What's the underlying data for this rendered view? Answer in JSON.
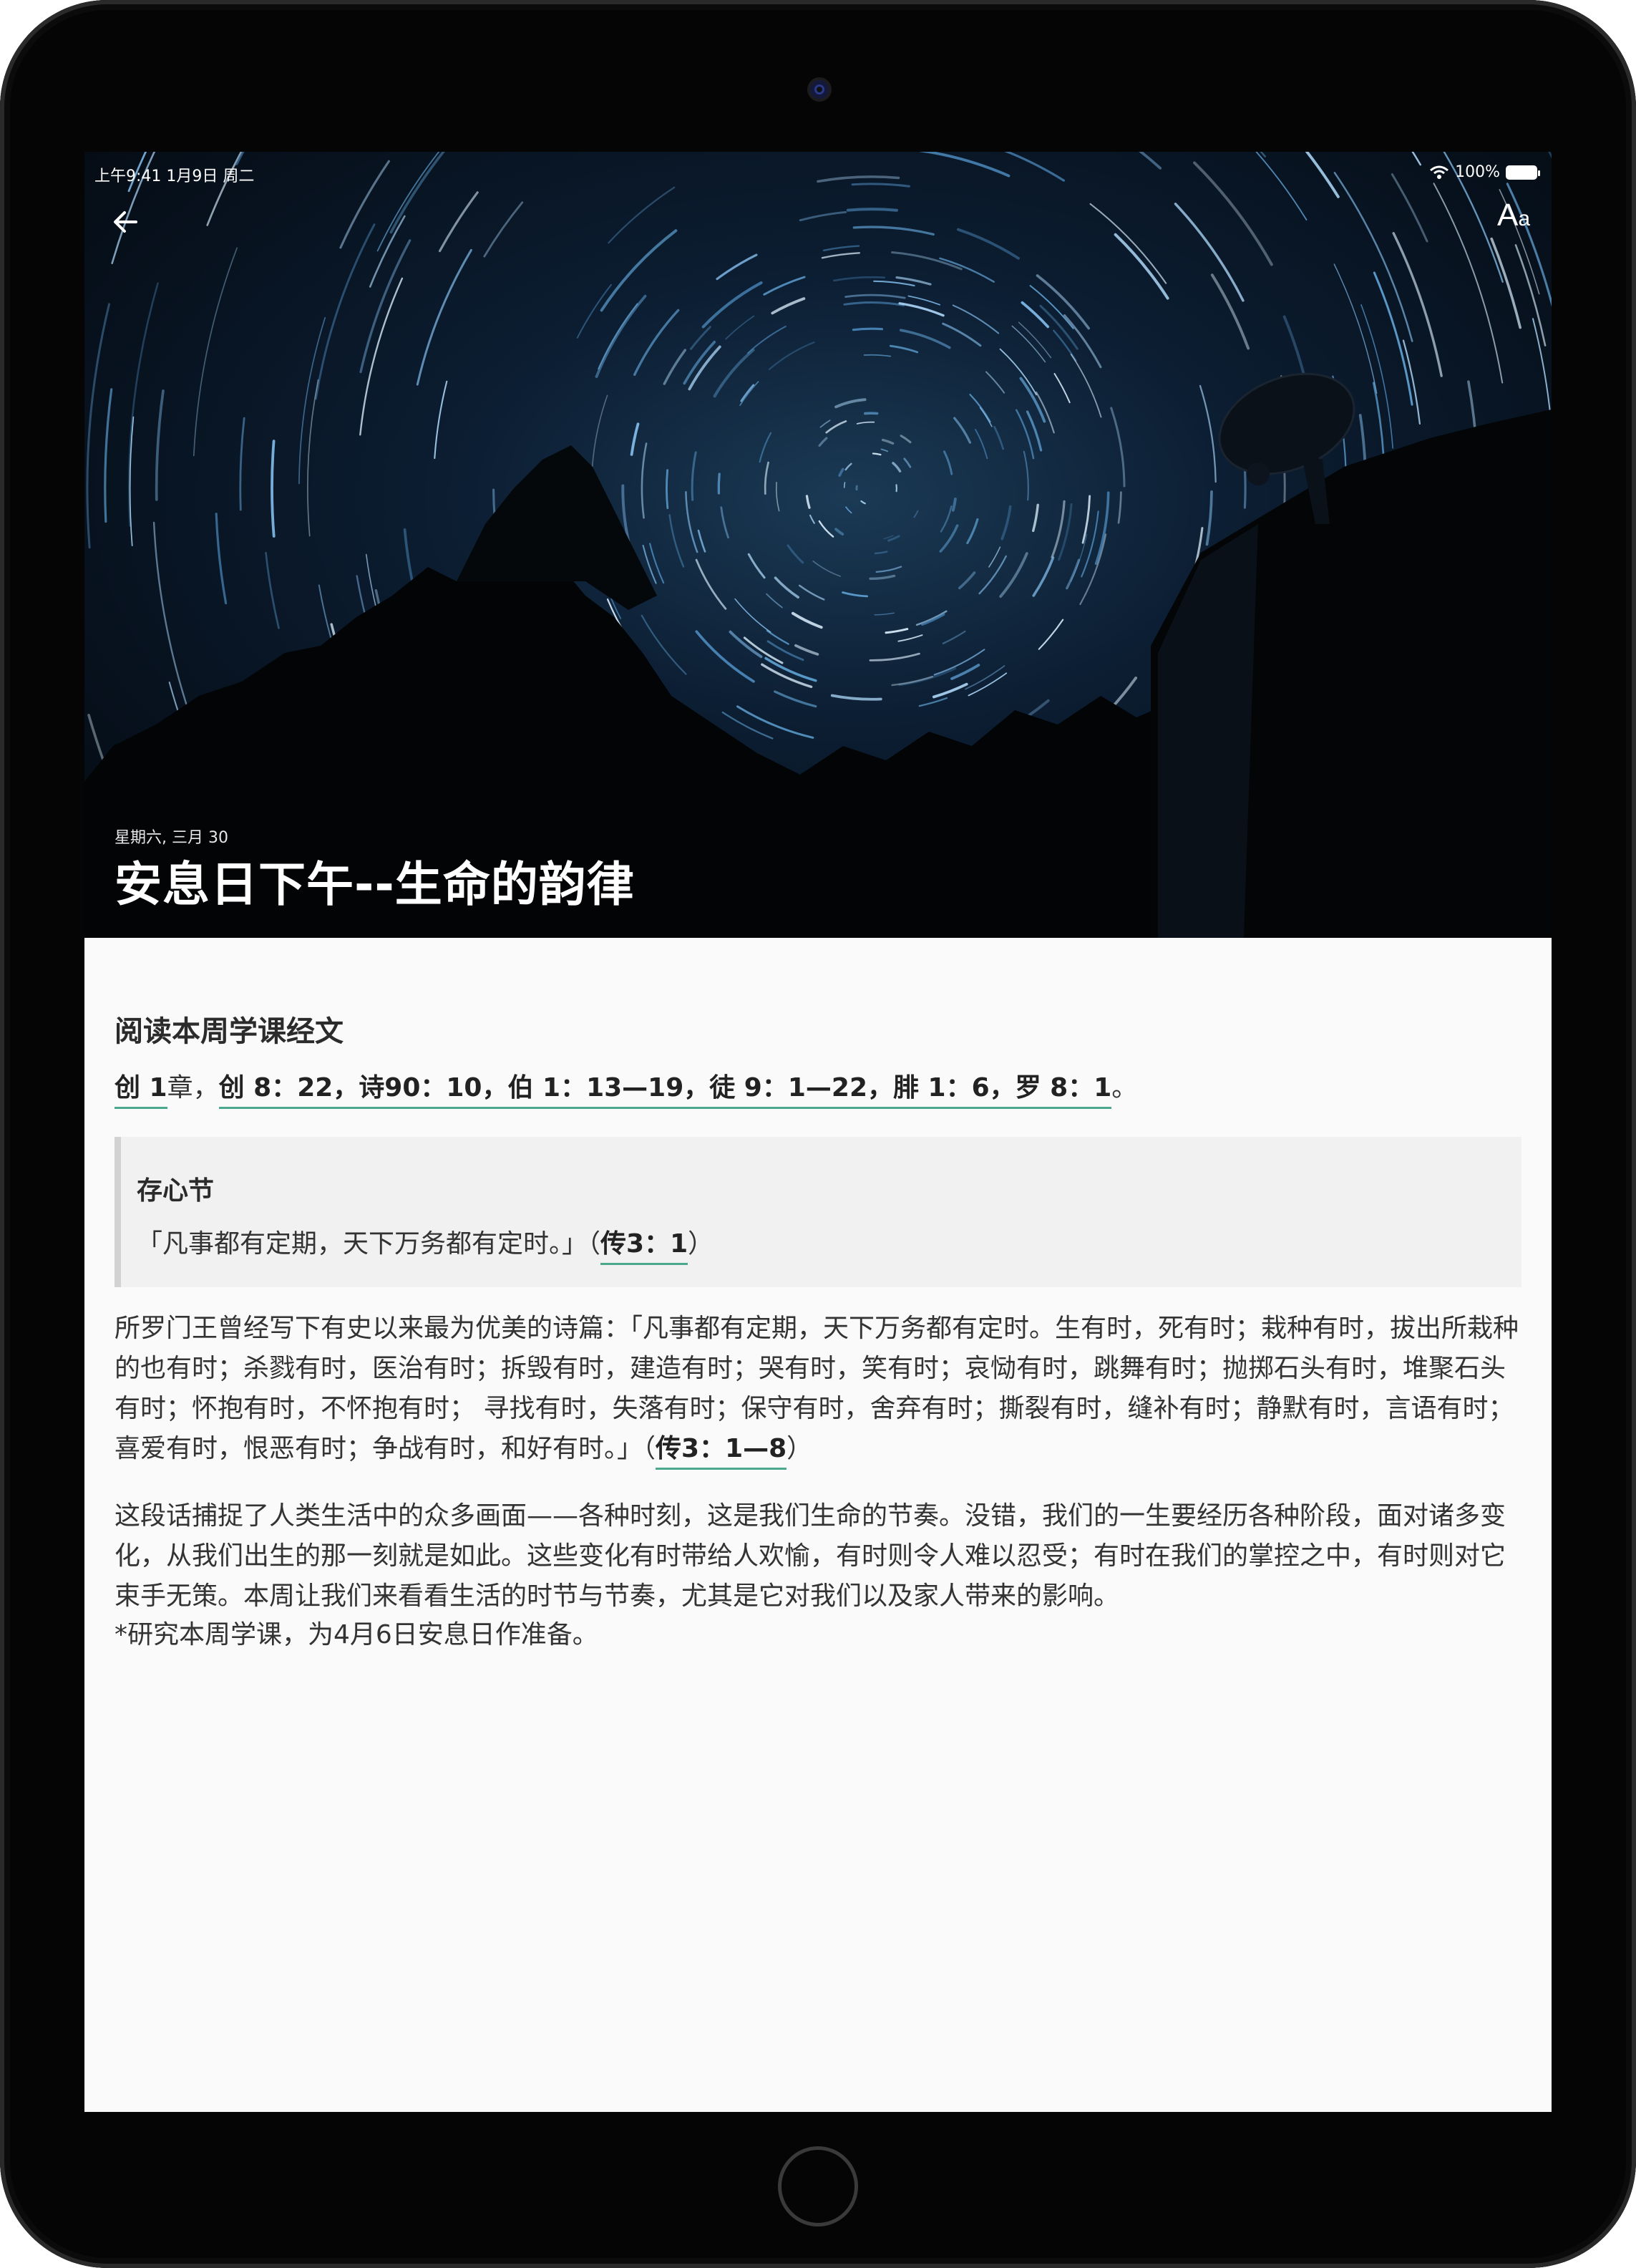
{
  "status_bar": {
    "time_date": "上午9:41   1月9日 周二",
    "battery": "100%"
  },
  "toolbar": {
    "font_button": "A",
    "font_button_small": "a"
  },
  "hero": {
    "date": "星期六, 三月 30",
    "title": "安息日下午--生命的韵律"
  },
  "reading": {
    "heading": "阅读本周学课经文",
    "refs": [
      {
        "text": "创 1",
        "link": true
      },
      {
        "text": "章，",
        "link": false
      },
      {
        "text": "创 8：22，诗90：10，伯 1：13—19，徒 9：1—22，腓 1：6，罗 8：1",
        "link": true
      },
      {
        "text": "。",
        "link": false
      }
    ]
  },
  "memory": {
    "title": "存心节",
    "quote": "「凡事都有定期，天下万务都有定时。」（",
    "ref": "传3：1",
    "close": "）"
  },
  "body": {
    "p1_text": "所罗门王曾经写下有史以来最为优美的诗篇：「凡事都有定期，天下万务都有定时。生有时，死有时；栽种有时，拔出所栽种的也有时；杀戮有时，医治有时；拆毁有时，建造有时；哭有时，笑有时；哀恸有时，跳舞有时；抛掷石头有时，堆聚石头有时；怀抱有时，不怀抱有时； 寻找有时，失落有时；保守有时，舍弃有时；撕裂有时，缝补有时；静默有时，言语有时；喜爱有时，恨恶有时；争战有时，和好有时。」（",
    "p1_ref": "传3：1—8",
    "p1_close": "）",
    "p2": "这段话捕捉了人类生活中的众多画面——各种时刻，这是我们生命的节奏。没错，我们的一生要经历各种阶段，面对诸多变化，从我们出生的那一刻就是如此。这些变化有时带给人欢愉，有时则令人难以忍受；有时在我们的掌控之中，有时则对它束手无策。本周让我们来看看生活的时节与节奏，尤其是它对我们以及家人带来的影响。",
    "p3": "*研究本周学课，为4月6日安息日作准备。"
  },
  "colors": {
    "link_underline": "#4aa88c",
    "background": "#fafafa",
    "quote_bg": "#f1f1f1"
  }
}
